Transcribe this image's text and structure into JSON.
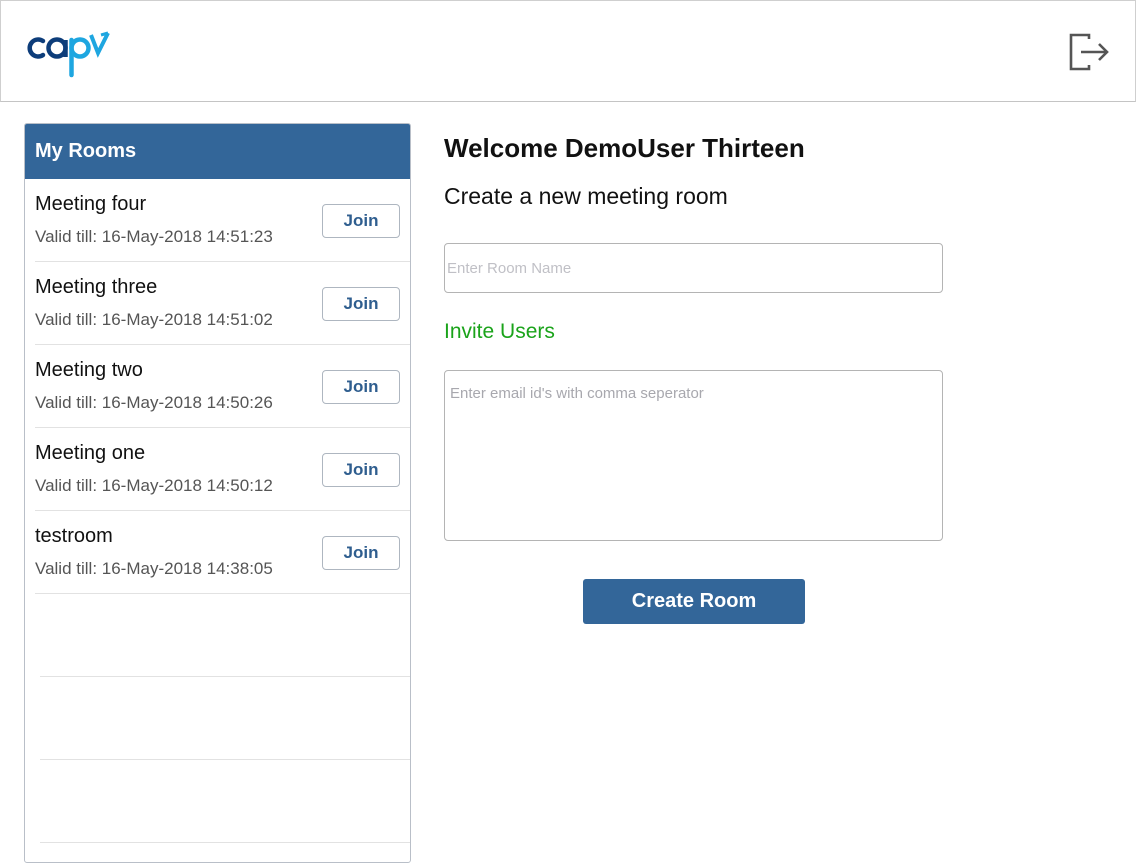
{
  "app": {
    "logo_text": "capv",
    "logout_icon": "logout-icon"
  },
  "colors": {
    "brand_blue": "#336699",
    "logo_cyan": "#1ea6e0",
    "logo_navy": "#0d3d7a",
    "invite_green": "#1aa31a"
  },
  "rooms": {
    "title": "My Rooms",
    "join_label": "Join",
    "items": [
      {
        "name": "Meeting four",
        "valid": "Valid till: 16-May-2018 14:51:23"
      },
      {
        "name": "Meeting three",
        "valid": "Valid till: 16-May-2018 14:51:02"
      },
      {
        "name": "Meeting two",
        "valid": "Valid till: 16-May-2018 14:50:26"
      },
      {
        "name": "Meeting one",
        "valid": "Valid till: 16-May-2018 14:50:12"
      },
      {
        "name": "testroom",
        "valid": "Valid till: 16-May-2018 14:38:05"
      }
    ]
  },
  "main": {
    "welcome": "Welcome DemoUser Thirteen",
    "create_title": "Create a new meeting room",
    "room_placeholder": "Enter Room Name",
    "invite_title": "Invite Users",
    "email_placeholder": "Enter email id's with comma seperator",
    "create_button": "Create Room"
  }
}
